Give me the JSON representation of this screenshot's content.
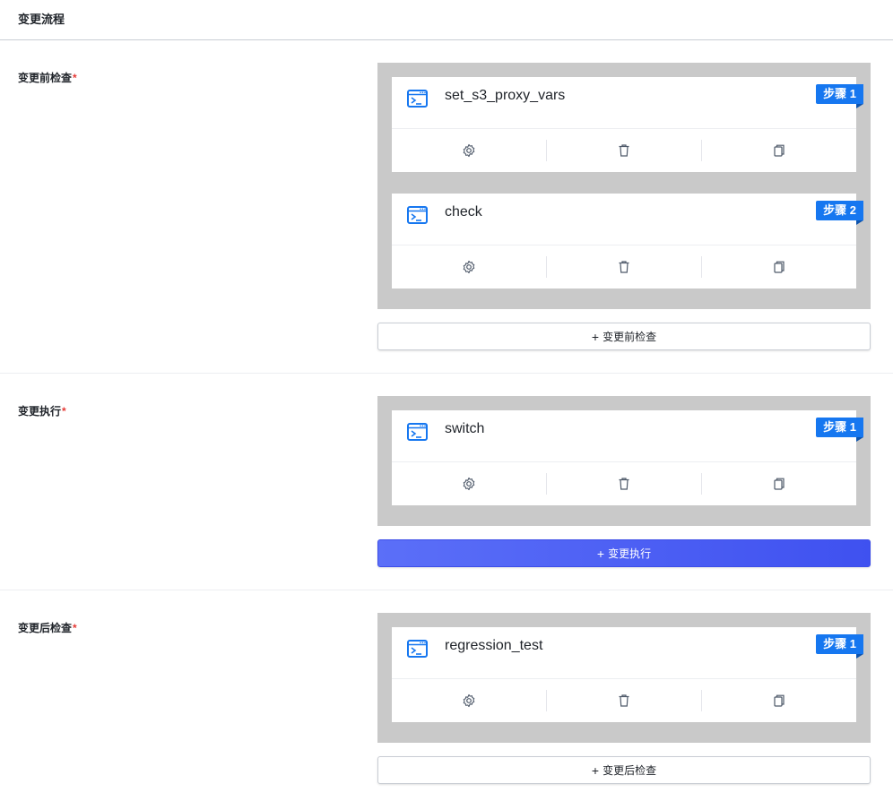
{
  "page": {
    "title": "变更流程"
  },
  "colors": {
    "accent": "#1677f0",
    "primary_button": "#4a5cf5",
    "step_area_bg": "#c9c9c9",
    "required": "#e53935"
  },
  "sections": [
    {
      "label": "变更前检查",
      "required_mark": "*",
      "steps": [
        {
          "name": "set_s3_proxy_vars",
          "badge": "步骤 1",
          "icon": "terminal-icon"
        },
        {
          "name": "check",
          "badge": "步骤 2",
          "icon": "terminal-icon"
        }
      ],
      "add_button": {
        "plus": "+",
        "label": "变更前检查",
        "style": "default"
      }
    },
    {
      "label": "变更执行",
      "required_mark": "*",
      "steps": [
        {
          "name": "switch",
          "badge": "步骤 1",
          "icon": "terminal-icon"
        }
      ],
      "add_button": {
        "plus": "+",
        "label": "变更执行",
        "style": "primary"
      }
    },
    {
      "label": "变更后检查",
      "required_mark": "*",
      "steps": [
        {
          "name": "regression_test",
          "badge": "步骤 1",
          "icon": "terminal-icon"
        }
      ],
      "add_button": {
        "plus": "+",
        "label": "变更后检查",
        "style": "default"
      }
    }
  ],
  "card_actions": [
    "gear-icon",
    "trash-icon",
    "copy-icon"
  ]
}
